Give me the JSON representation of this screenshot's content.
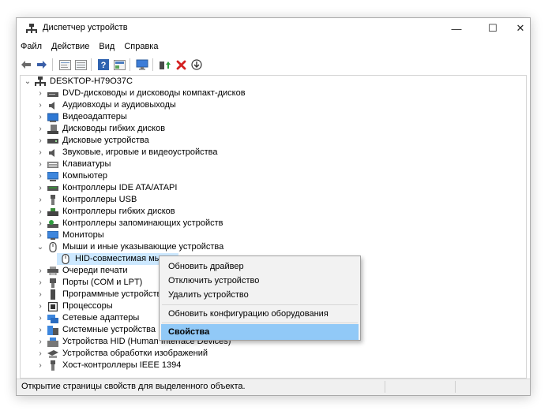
{
  "window": {
    "title": "Диспетчер устройств",
    "controls": {
      "minimize": "—",
      "maximize": "☐",
      "close": "✕"
    }
  },
  "menu": [
    "Файл",
    "Действие",
    "Вид",
    "Справка"
  ],
  "toolbar": [
    "back-icon",
    "forward-icon",
    "properties-icon",
    "update-list-icon",
    "help-icon",
    "view-icon",
    "scan-hardware-icon",
    "update-driver-icon",
    "disable-icon",
    "uninstall-icon"
  ],
  "tree": {
    "root": "DESKTOP-H79O37C",
    "categories": [
      "DVD-дисководы и дисководы компакт-дисков",
      "Аудиовходы и аудиовыходы",
      "Видеоадаптеры",
      "Дисководы гибких дисков",
      "Дисковые устройства",
      "Звуковые, игровые и видеоустройства",
      "Клавиатуры",
      "Компьютер",
      "Контроллеры IDE ATA/ATAPI",
      "Контроллеры USB",
      "Контроллеры гибких дисков",
      "Контроллеры запоминающих устройств",
      "Мониторы",
      "Мыши и иные указывающие устройства",
      "HID-совместимая мышь",
      "Очереди печати",
      "Порты (COM и LPT)",
      "Программные устройства",
      "Процессоры",
      "Сетевые адаптеры",
      "Системные устройства",
      "Устройства HID (Human Interface Devices)",
      "Устройства обработки изображений",
      "Хост-контроллеры IEEE 1394"
    ]
  },
  "context_menu": {
    "update_driver": "Обновить драйвер",
    "disable_device": "Отключить устройство",
    "uninstall_device": "Удалить устройство",
    "scan_hardware": "Обновить конфигурацию оборудования",
    "properties": "Свойства"
  },
  "status": "Открытие страницы свойств для выделенного объекта."
}
